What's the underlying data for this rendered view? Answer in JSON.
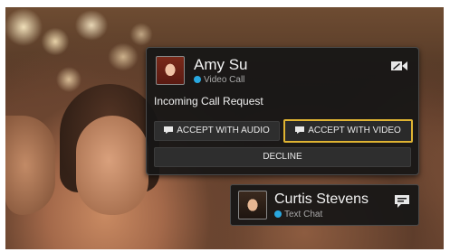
{
  "call_notification": {
    "caller_name": "Amy Su",
    "service_label": "Video Call",
    "message": "Incoming Call Request",
    "accept_audio_label": "ACCEPT WITH AUDIO",
    "accept_video_label": "ACCEPT WITH VIDEO",
    "decline_label": "DECLINE",
    "call_type_icon": "video-camera-icon"
  },
  "chat_notification": {
    "contact_name": "Curtis Stevens",
    "service_label": "Text Chat",
    "type_icon": "chat-bubble-icon"
  },
  "colors": {
    "focus_border": "#e0b432",
    "service_dot": "#29a8e0",
    "panel_bg": "#161616"
  }
}
